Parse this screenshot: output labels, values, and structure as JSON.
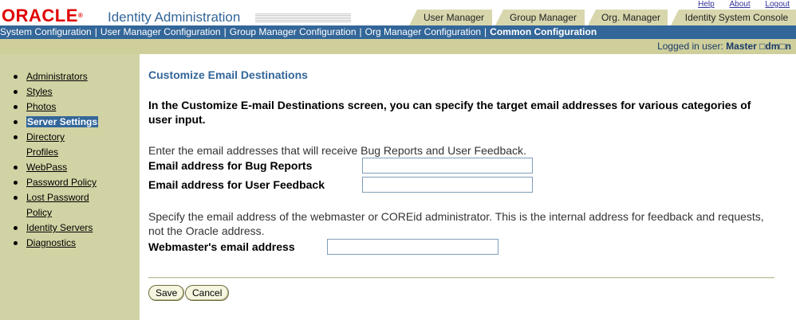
{
  "header": {
    "logo": "ORACLE",
    "app_title": "Identity Administration",
    "top_links": [
      "Help",
      "About",
      "Logout"
    ],
    "tabs": [
      "User Manager",
      "Group Manager",
      "Org. Manager",
      "Identity System Console"
    ]
  },
  "nav_bar": {
    "items": [
      "System Configuration",
      "User Manager Configuration",
      "Group Manager Configuration",
      "Org Manager Configuration",
      "Common Configuration"
    ],
    "active": "Common Configuration"
  },
  "login": {
    "label": "Logged in user:",
    "user": "Master □dm□n"
  },
  "sidebar": {
    "items": [
      {
        "label": "Administrators"
      },
      {
        "label": "Styles"
      },
      {
        "label": "Photos"
      },
      {
        "label": "Server Settings",
        "selected": true
      },
      {
        "label": "Directory Profiles"
      },
      {
        "label": "WebPass"
      },
      {
        "label": "Password Policy"
      },
      {
        "label": "Lost Password Policy"
      },
      {
        "label": "Identity Servers"
      },
      {
        "label": "Diagnostics"
      }
    ]
  },
  "main": {
    "title": "Customize Email Destinations",
    "intro": "In the Customize E-mail Destinations screen, you can specify the target email addresses for various categories of user input.",
    "section1_desc": "Enter the email addresses that will receive Bug Reports and User Feedback.",
    "bug_reports_label": "Email address for Bug Reports",
    "bug_reports_value": "",
    "user_feedback_label": "Email address for User Feedback",
    "user_feedback_value": "",
    "section2_desc": "Specify the email address of the webmaster or COREid administrator. This is the internal address for feedback and requests, not the Oracle address.",
    "webmaster_label": "Webmaster's email address",
    "webmaster_value": "",
    "save_label": "Save",
    "cancel_label": "Cancel"
  },
  "colors": {
    "accent_blue": "#336699",
    "sidebar_bg": "#d2d3a4",
    "tab_bg": "#d8d6ad",
    "logo_red": "#e00000"
  }
}
